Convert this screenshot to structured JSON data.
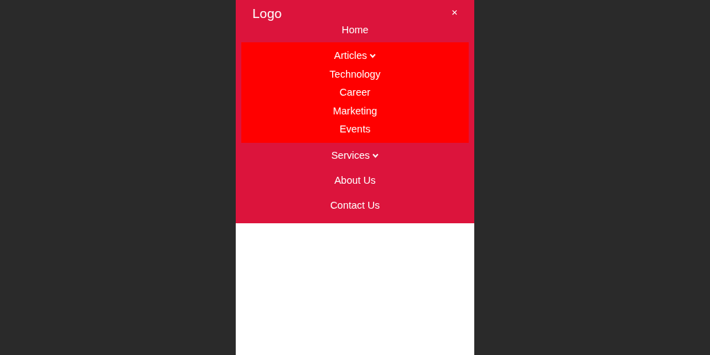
{
  "logo": "Logo",
  "close_button": "×",
  "nav": [
    {
      "label": "Home",
      "kind": "link"
    },
    {
      "label": "Articles",
      "kind": "dropdown",
      "expanded": true,
      "children": [
        {
          "label": "Technology"
        },
        {
          "label": "Career"
        },
        {
          "label": "Marketing"
        },
        {
          "label": "Events"
        }
      ]
    },
    {
      "label": "Services",
      "kind": "dropdown",
      "expanded": false
    },
    {
      "label": "About Us",
      "kind": "link"
    },
    {
      "label": "Contact Us",
      "kind": "link"
    }
  ]
}
